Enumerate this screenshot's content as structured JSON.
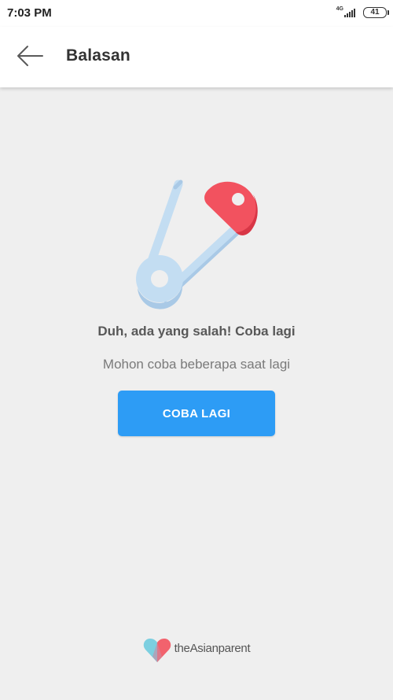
{
  "status_bar": {
    "time": "7:03 PM",
    "network": "4G",
    "battery": "41",
    "signal_level": 4
  },
  "header": {
    "back_icon": "arrow-left-icon",
    "title": "Balasan"
  },
  "illustration": {
    "icon": "safety-pin-icon",
    "colors": {
      "pin_body": "#c3ddf2",
      "pin_shadow": "#a9c9e6",
      "pin_head": "#f2525f",
      "pin_head_shadow": "#d83646"
    }
  },
  "error": {
    "title": "Duh, ada yang salah! Coba lagi",
    "subtitle": "Mohon coba beberapa saat lagi"
  },
  "retry_button": {
    "label": "COBA LAGI",
    "color": "#2d9cf5"
  },
  "brand": {
    "logo_icon": "heart-logo-icon",
    "name": "theAsianparent"
  }
}
